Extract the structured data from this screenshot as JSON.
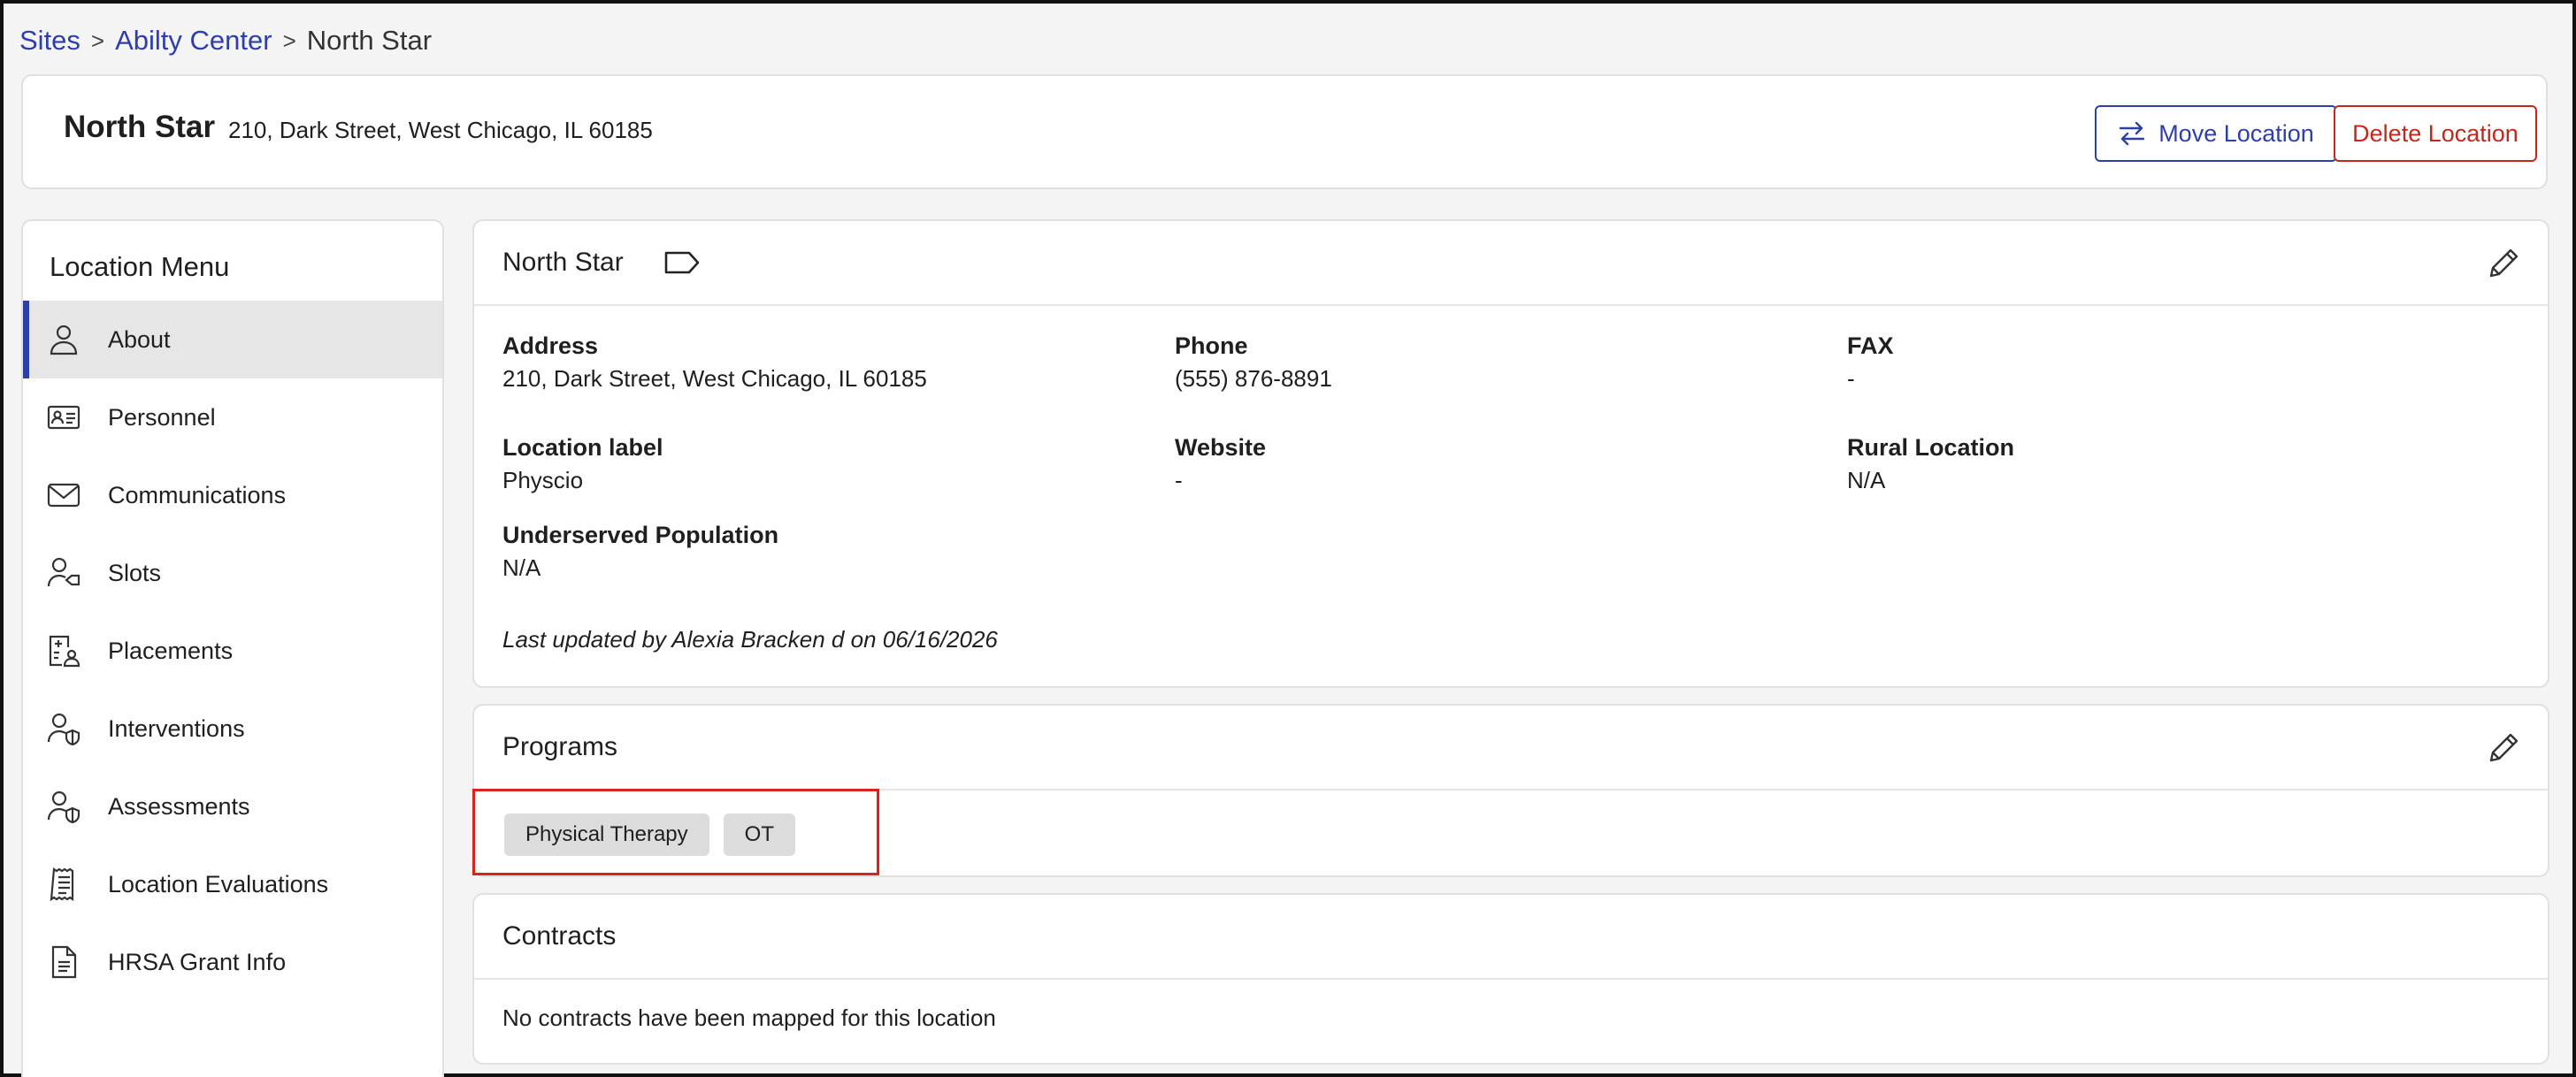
{
  "breadcrumb": {
    "items": [
      "Sites",
      "Abilty Center"
    ],
    "separator": ">",
    "current": "North Star"
  },
  "header": {
    "title": "North Star",
    "address": "210, Dark Street, West Chicago, IL 60185",
    "move_label": "Move Location",
    "delete_label": "Delete Location"
  },
  "sidebar": {
    "title": "Location Menu",
    "items": [
      {
        "label": "About",
        "icon": "person-icon",
        "active": true
      },
      {
        "label": "Personnel",
        "icon": "id-card-icon"
      },
      {
        "label": "Communications",
        "icon": "envelope-icon"
      },
      {
        "label": "Slots",
        "icon": "person-tag-icon"
      },
      {
        "label": "Placements",
        "icon": "clipboard-person-icon"
      },
      {
        "label": "Interventions",
        "icon": "person-shield-icon"
      },
      {
        "label": "Assessments",
        "icon": "person-shield-icon"
      },
      {
        "label": "Location Evaluations",
        "icon": "receipt-icon"
      },
      {
        "label": "HRSA Grant Info",
        "icon": "document-icon"
      }
    ]
  },
  "about": {
    "title": "North Star",
    "fields": {
      "address": {
        "label": "Address",
        "value": "210, Dark Street, West Chicago, IL 60185"
      },
      "phone": {
        "label": "Phone",
        "value": "(555) 876-8891"
      },
      "fax": {
        "label": "FAX",
        "value": "-"
      },
      "location_label": {
        "label": "Location label",
        "value": "Physcio"
      },
      "website": {
        "label": "Website",
        "value": "-"
      },
      "rural": {
        "label": "Rural Location",
        "value": "N/A"
      },
      "underserved": {
        "label": "Underserved Population",
        "value": "N/A"
      }
    },
    "last_updated": "Last updated by Alexia Bracken d on 06/16/2026"
  },
  "programs": {
    "title": "Programs",
    "chips": [
      "Physical Therapy",
      "OT"
    ]
  },
  "contracts": {
    "title": "Contracts",
    "empty_text": "No contracts have been mapped for this location"
  },
  "colors": {
    "accent": "#2f3ea8",
    "danger": "#c0281f",
    "highlight": "#d9231d"
  }
}
